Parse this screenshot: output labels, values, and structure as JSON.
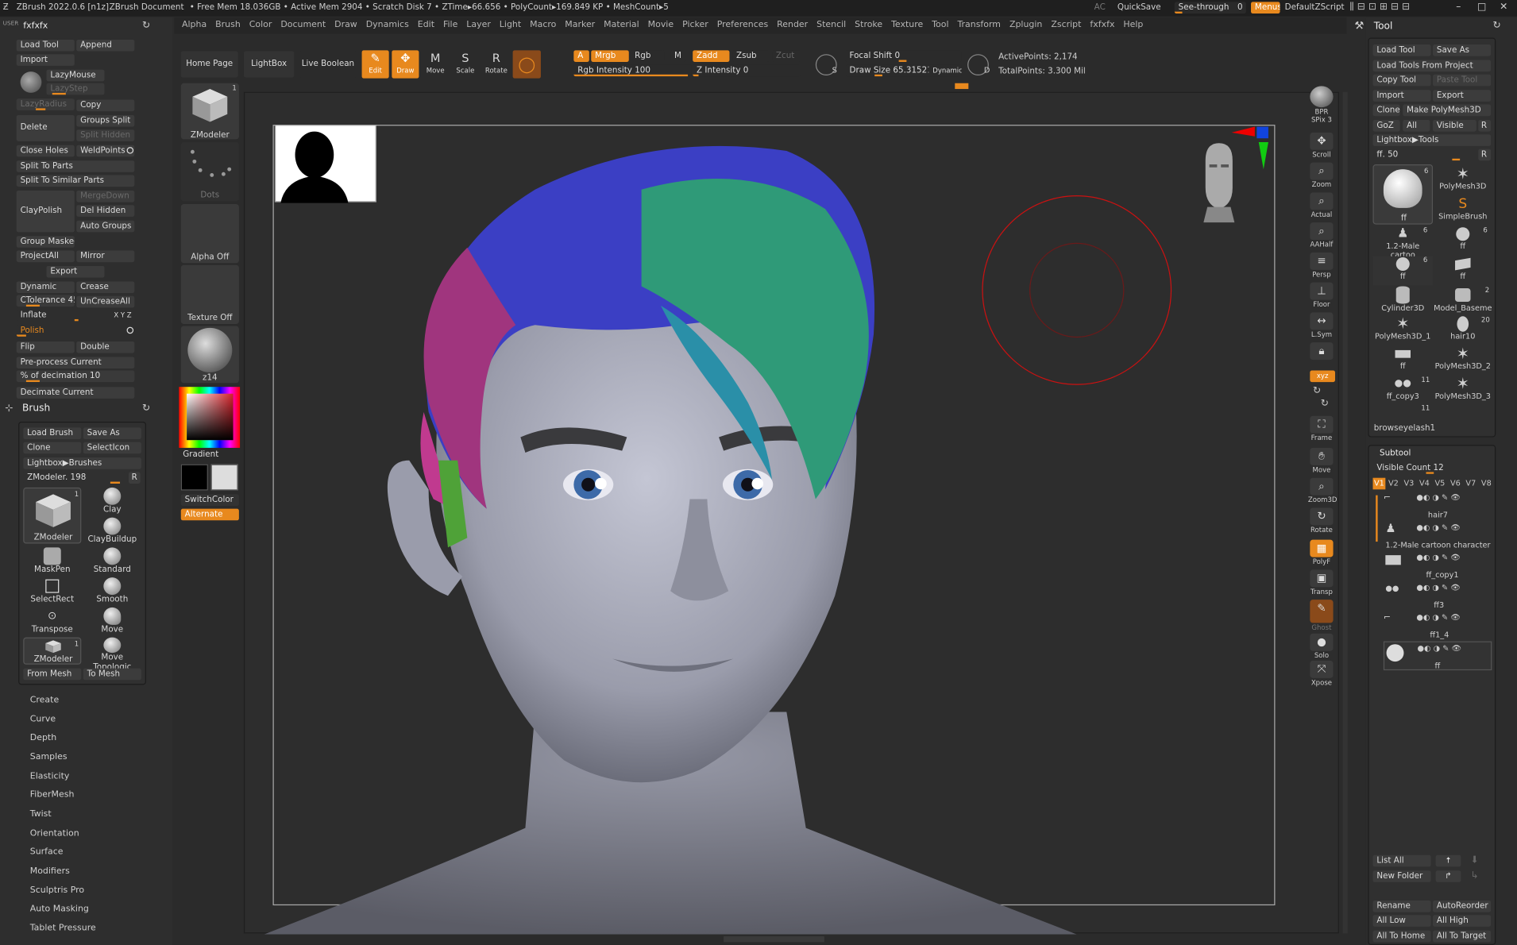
{
  "titlebar": {
    "app": "ZBrush 2022.0.6 [n1z]",
    "doc": "ZBrush Document",
    "stats": "• Free Mem 18.036GB • Active Mem 2904 • Scratch Disk 7 • ZTime▸66.656 • PolyCount▸169.849 KP • MeshCount▸5",
    "ac": "AC",
    "quicksave": "QuickSave",
    "seethrough": "See-through",
    "seethrough_val": "0",
    "menus": "Menus",
    "script": "DefaultZScript"
  },
  "menus": [
    "Alpha",
    "Brush",
    "Color",
    "Document",
    "Draw",
    "Dynamics",
    "Edit",
    "File",
    "Layer",
    "Light",
    "Macro",
    "Marker",
    "Material",
    "Movie",
    "Picker",
    "Preferences",
    "Render",
    "Stencil",
    "Stroke",
    "Texture",
    "Tool",
    "Transform",
    "Zplugin",
    "Zscript",
    "fxfxfx",
    "Help"
  ],
  "left": {
    "user": "USER",
    "title": "fxfxfx",
    "load_tool": "Load Tool",
    "append": "Append",
    "import": "Import",
    "lazymouse": "LazyMouse",
    "lazystep": "LazyStep",
    "lazyradius": "LazyRadius",
    "copy": "Copy",
    "delete": "Delete",
    "groups_split": "Groups Split",
    "split_hidden": "Split Hidden",
    "close_holes": "Close Holes",
    "weldpoints": "WeldPoints",
    "split_to_parts": "Split To Parts",
    "split_similar": "Split To Similar Parts",
    "claypolish": "ClayPolish",
    "mergedown": "MergeDown",
    "del_hidden": "Del Hidden",
    "auto_groups": "Auto Groups",
    "group_masked": "Group Masked",
    "projectall": "ProjectAll",
    "mirror": "Mirror",
    "export": "Export",
    "dynamic": "Dynamic",
    "crease": "Crease",
    "ctolerance": "CTolerance",
    "ctolerance_val": "45",
    "uncreaseall": "UnCreaseAll",
    "inflate": "Inflate",
    "xyz": "X Y Z",
    "polish": "Polish",
    "flip": "Flip",
    "double": "Double",
    "preprocess": "Pre-process Current",
    "pct_decimation": "% of decimation",
    "pct_val": "10",
    "decimate": "Decimate Current",
    "brush_title": "Brush",
    "load_brush": "Load Brush",
    "save_as": "Save As",
    "clone": "Clone",
    "selecticon": "SelectIcon",
    "lightbox_brushes": "Lightbox▶Brushes",
    "zmodeler_val": "ZModeler.",
    "zmodeler_num": "198",
    "r": "R",
    "brushes": [
      {
        "n": "ZModeler",
        "c": "1"
      },
      {
        "n": "Clay"
      },
      {
        "n": "ClayBuildup"
      },
      {
        "n": "MaskPen"
      },
      {
        "n": "Standard"
      },
      {
        "n": "SelectRect"
      },
      {
        "n": "Smooth"
      },
      {
        "n": "Transpose"
      },
      {
        "n": "Move"
      },
      {
        "n": "ZModeler",
        "c": "1"
      },
      {
        "n": "Move Topologic"
      }
    ],
    "from_mesh": "From Mesh",
    "to_mesh": "To Mesh",
    "submenus": [
      "Create",
      "Curve",
      "Depth",
      "Samples",
      "Elasticity",
      "FiberMesh",
      "Twist",
      "Orientation",
      "Surface",
      "Modifiers",
      "Sculptris Pro",
      "Auto Masking",
      "Tablet Pressure"
    ]
  },
  "shelf": {
    "zmodeler": "ZModeler",
    "zmodeler_count": "1",
    "dots": "Dots",
    "alpha_off": "Alpha Off",
    "texture_off": "Texture Off",
    "material": "z14",
    "gradient": "Gradient",
    "switchcolor": "SwitchColor",
    "alternate": "Alternate"
  },
  "toolbar": {
    "home": "Home Page",
    "lightbox": "LightBox",
    "live_boolean": "Live Boolean",
    "edit": "Edit",
    "draw": "Draw",
    "move": "Move",
    "scale": "Scale",
    "rotate": "Rotate",
    "a": "A",
    "mrgb": "Mrgb",
    "rgb": "Rgb",
    "m": "M",
    "zadd": "Zadd",
    "zsub": "Zsub",
    "zcut": "Zcut",
    "rgb_intensity": "Rgb Intensity",
    "rgb_intensity_val": "100",
    "z_intensity": "Z Intensity",
    "z_intensity_val": "0",
    "focal_shift": "Focal Shift",
    "focal_shift_val": "0",
    "draw_size": "Draw Size",
    "draw_size_val": "65.31521",
    "dynamic": "Dynamic",
    "s": "S",
    "d": "D",
    "active_points": "ActivePoints: 2,174",
    "total_points": "TotalPoints: 3.300 Mil"
  },
  "rightbar": [
    {
      "n": "BPR",
      "l": "SPix 3"
    },
    {
      "n": "Scroll"
    },
    {
      "n": "Zoom"
    },
    {
      "n": "Actual"
    },
    {
      "n": "AAHalf"
    },
    {
      "n": "Persp"
    },
    {
      "n": "Floor"
    },
    {
      "n": "L.Sym"
    },
    {
      "n": "Lock"
    },
    {
      "n": "Frame"
    },
    {
      "n": "Move"
    },
    {
      "n": "Zoom3D"
    },
    {
      "n": "Rotate"
    },
    {
      "n": "PolyF"
    },
    {
      "n": "Transp"
    },
    {
      "n": "Ghost"
    },
    {
      "n": "Solo"
    },
    {
      "n": "Xpose"
    }
  ],
  "tool": {
    "title": "Tool",
    "load_tool": "Load Tool",
    "save_as": "Save As",
    "load_from_project": "Load Tools From Project",
    "copy_tool": "Copy Tool",
    "paste_tool": "Paste Tool",
    "import": "Import",
    "export": "Export",
    "clone": "Clone",
    "make_polymesh": "Make PolyMesh3D",
    "goz": "GoZ",
    "all": "All",
    "visible": "Visible",
    "r": "R",
    "lightbox_tools": "Lightbox▶Tools",
    "ff": "ff.",
    "ff_val": "50",
    "items": [
      {
        "n": "ff",
        "c": "6"
      },
      {
        "n": "PolyMesh3D"
      },
      {
        "n": "SimpleBrush"
      },
      {
        "n": "1.2-Male cartoo",
        "c": "6"
      },
      {
        "n": "ff",
        "c": "6"
      },
      {
        "n": "ff",
        "c": "6"
      },
      {
        "n": "ff"
      },
      {
        "n": "Cylinder3D"
      },
      {
        "n": "Model_Baseme",
        "c": "2"
      },
      {
        "n": "PolyMesh3D_1"
      },
      {
        "n": "hair10",
        "c": "20"
      },
      {
        "n": "ff"
      },
      {
        "n": "PolyMesh3D_2"
      },
      {
        "n": "ff_copy3",
        "c": "11"
      },
      {
        "n": "PolyMesh3D_3"
      },
      {
        "n": "",
        "c": "11"
      }
    ],
    "browse": "browseyelash1"
  },
  "subtool": {
    "title": "Subtool",
    "visible_count": "Visible Count",
    "visible_count_val": "12",
    "versions": [
      "V1",
      "V2",
      "V3",
      "V4",
      "V5",
      "V6",
      "V7",
      "V8"
    ],
    "items": [
      "hair7",
      "1.2-Male cartoon character",
      "ff_copy1",
      "ff3",
      "ff1_4",
      "ff"
    ],
    "list_all": "List All",
    "new_folder": "New Folder",
    "rename": "Rename",
    "autoreorder": "AutoReorder",
    "all_low": "All Low",
    "all_high": "All High",
    "all_to_home": "All To Home",
    "all_to_target": "All To Target"
  },
  "colors": {
    "accent": "#e8891e",
    "bg": "#2b2b2b",
    "hair_blue": "#3b3fc4",
    "hair_green": "#2f9a78",
    "hair_magenta": "#a0357e",
    "hair_cyan": "#2a8fa8",
    "skin": "#a5a7b6"
  }
}
